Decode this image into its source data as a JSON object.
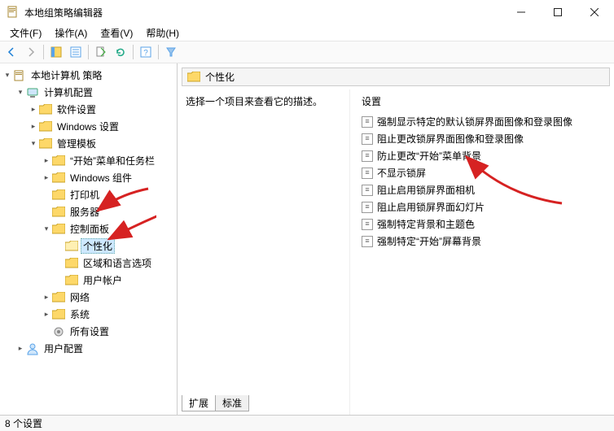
{
  "window": {
    "title": "本地组策略编辑器"
  },
  "menu": {
    "file": "文件(F)",
    "action": "操作(A)",
    "view": "查看(V)",
    "help": "帮助(H)"
  },
  "tree": {
    "root": "本地计算机 策略",
    "computer": "计算机配置",
    "software": "软件设置",
    "windows_settings": "Windows 设置",
    "admin_templates": "管理模板",
    "start_taskbar": "“开始”菜单和任务栏",
    "windows_components": "Windows 组件",
    "printers": "打印机",
    "servers": "服务器",
    "control_panel": "控制面板",
    "personalization": "个性化",
    "region_language": "区域和语言选项",
    "user_accounts": "用户帐户",
    "network": "网络",
    "system": "系统",
    "all_settings": "所有设置",
    "user_config": "用户配置"
  },
  "breadcrumb": {
    "label": "个性化"
  },
  "description": {
    "prompt": "选择一个项目来查看它的描述。"
  },
  "list": {
    "header": "设置",
    "items": [
      "强制显示特定的默认锁屏界面图像和登录图像",
      "阻止更改锁屏界面图像和登录图像",
      "防止更改“开始”菜单背景",
      "不显示锁屏",
      "阻止启用锁屏界面相机",
      "阻止启用锁屏界面幻灯片",
      "强制特定背景和主题色",
      "强制特定“开始”屏幕背景"
    ]
  },
  "tabs": {
    "extended": "扩展",
    "standard": "标准"
  },
  "status": "8 个设置"
}
